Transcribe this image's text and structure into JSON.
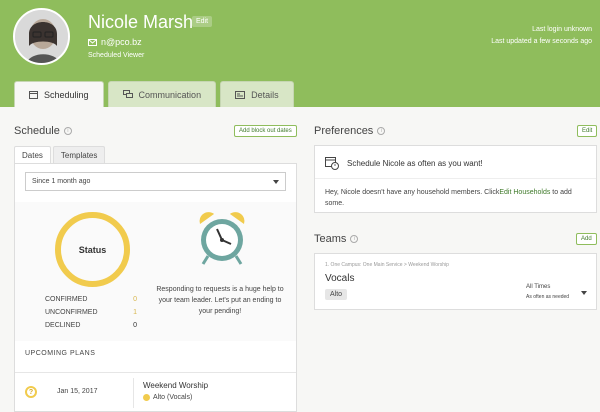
{
  "header": {
    "name": "Nicole Marsh",
    "edit_label": "Edit",
    "email": "n@pco.bz",
    "role": "Scheduled Viewer",
    "last_login": "Last login unknown",
    "last_updated": "Last updated a few seconds ago"
  },
  "tabs": [
    {
      "label": "Scheduling",
      "icon": "calendar-icon",
      "active": true
    },
    {
      "label": "Communication",
      "icon": "chat-icon",
      "active": false
    },
    {
      "label": "Details",
      "icon": "card-icon",
      "active": false
    }
  ],
  "schedule": {
    "title": "Schedule",
    "add_blockout_label": "Add block out dates",
    "subtabs": [
      "Dates",
      "Templates"
    ],
    "filter_value": "Since 1 month ago",
    "status_label": "Status",
    "stats": [
      {
        "label": "CONFIRMED",
        "value": "0"
      },
      {
        "label": "UNCONFIRMED",
        "value": "1"
      },
      {
        "label": "DECLINED",
        "value": "0"
      }
    ],
    "message": "Responding to requests is a huge help to your team leader. Let's put an ending to your pending!",
    "upcoming_title": "UPCOMING PLANS",
    "plans": [
      {
        "date": "Jan 15, 2017",
        "name": "Weekend Worship",
        "position": "Alto (Vocals)"
      }
    ]
  },
  "preferences": {
    "title": "Preferences",
    "edit_label": "Edit",
    "schedule_text": "Schedule Nicole as often as you want!",
    "household_text_prefix": "Hey, Nicole doesn't have any household members. Click",
    "household_link": "Edit Households",
    "household_text_suffix": " to add some."
  },
  "teams": {
    "title": "Teams",
    "add_label": "Add",
    "items": [
      {
        "path": "1. One Campus: One Main Service > Weekend Worship",
        "name": "Vocals",
        "position": "Alto",
        "times": "All Times",
        "frequency": "As often as needed"
      }
    ]
  },
  "colors": {
    "header_green": "#8fbd5c",
    "status_yellow": "#f1cb4d",
    "link_green": "#3f7a2a"
  }
}
